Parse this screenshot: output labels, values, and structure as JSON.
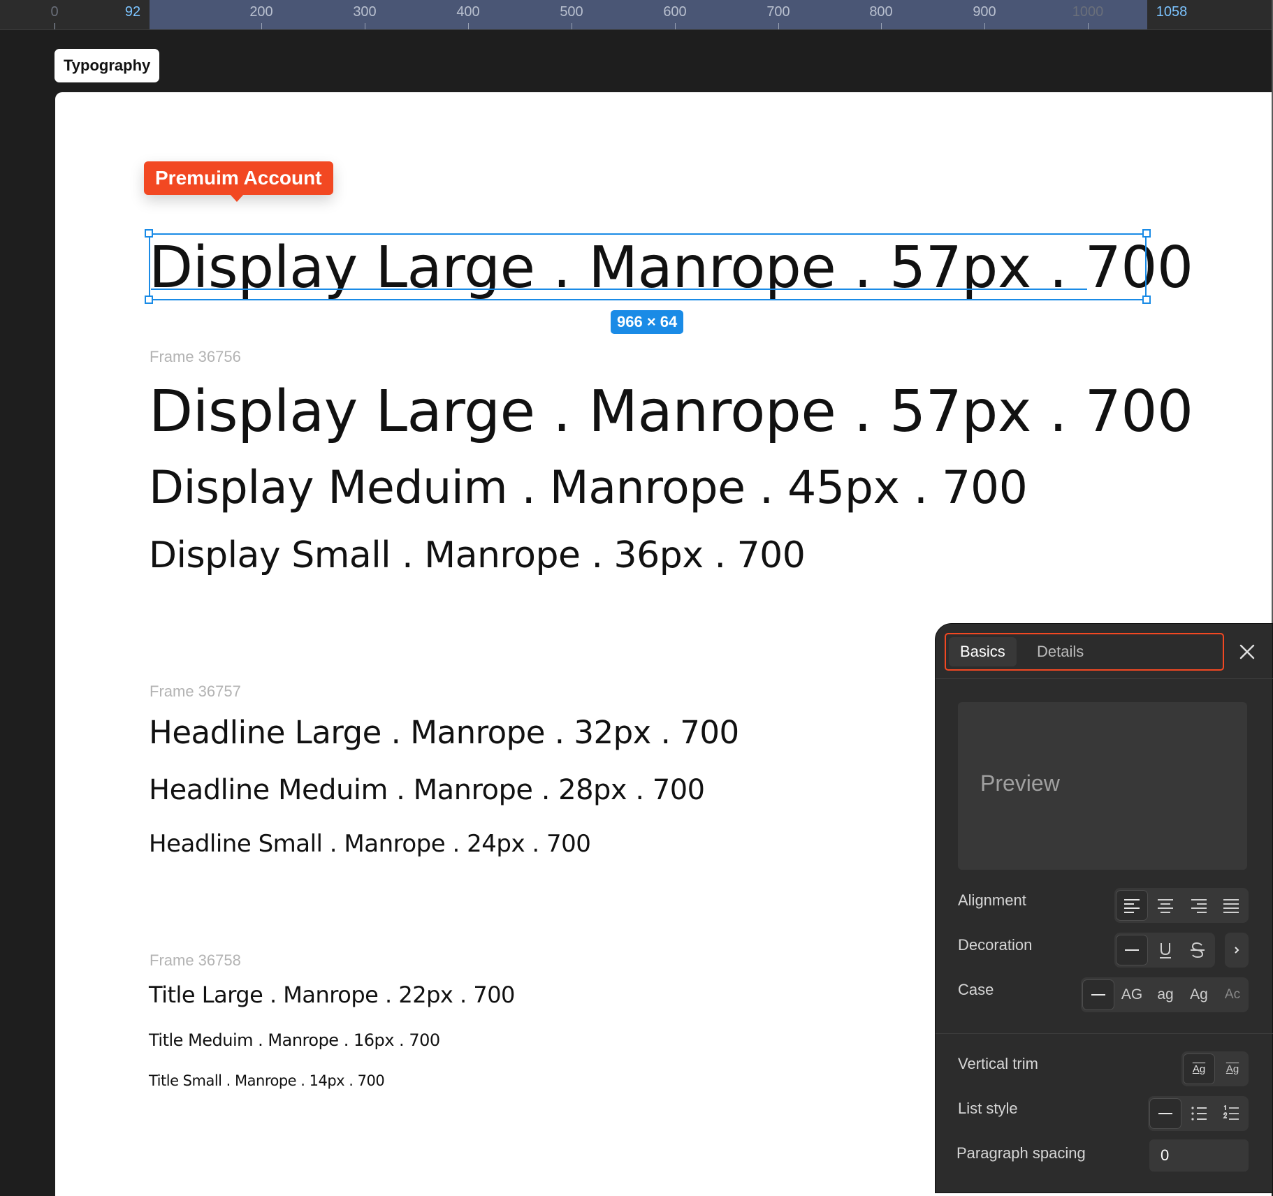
{
  "ruler": {
    "ticks": [
      "0",
      "92",
      "200",
      "300",
      "400",
      "500",
      "600",
      "700",
      "800",
      "900",
      "1000",
      "1058"
    ]
  },
  "frame_label": "Typography",
  "badge": "Premuim Account",
  "selection": {
    "dimensions": "966 × 64"
  },
  "groups": [
    {
      "label": "",
      "styles": [
        "Display Large . Manrope . 57px . 700"
      ]
    },
    {
      "label": "Frame 36756",
      "styles": [
        "Display Large . Manrope . 57px . 700",
        "Display Meduim . Manrope . 45px . 700",
        "Display Small . Manrope . 36px . 700"
      ]
    },
    {
      "label": "Frame 36757",
      "styles": [
        "Headline Large . Manrope . 32px . 700",
        "Headline Meduim . Manrope . 28px . 700",
        "Headline Small . Manrope . 24px . 700"
      ]
    },
    {
      "label": "Frame 36758",
      "styles": [
        "Title Large . Manrope . 22px . 700",
        "Title Meduim . Manrope . 16px . 700",
        "Title Small . Manrope . 14px . 700"
      ]
    }
  ],
  "panel": {
    "tabs": [
      "Basics",
      "Details"
    ],
    "active_tab": "Basics",
    "preview": "Preview",
    "rows": {
      "alignment": "Alignment",
      "decoration": "Decoration",
      "case": "Case",
      "vertical_trim": "Vertical trim",
      "list_style": "List style",
      "paragraph_spacing": "Paragraph spacing"
    },
    "case_options": [
      "AG",
      "ag",
      "Ag",
      "Ac"
    ],
    "vertical_trim_glyph": "Ag",
    "paragraph_spacing_value": "0"
  },
  "colors": {
    "accent": "#f24822",
    "selection": "#1a8be6",
    "panel_bg": "#2c2c2c",
    "canvas_bg": "#1e1e1e"
  }
}
